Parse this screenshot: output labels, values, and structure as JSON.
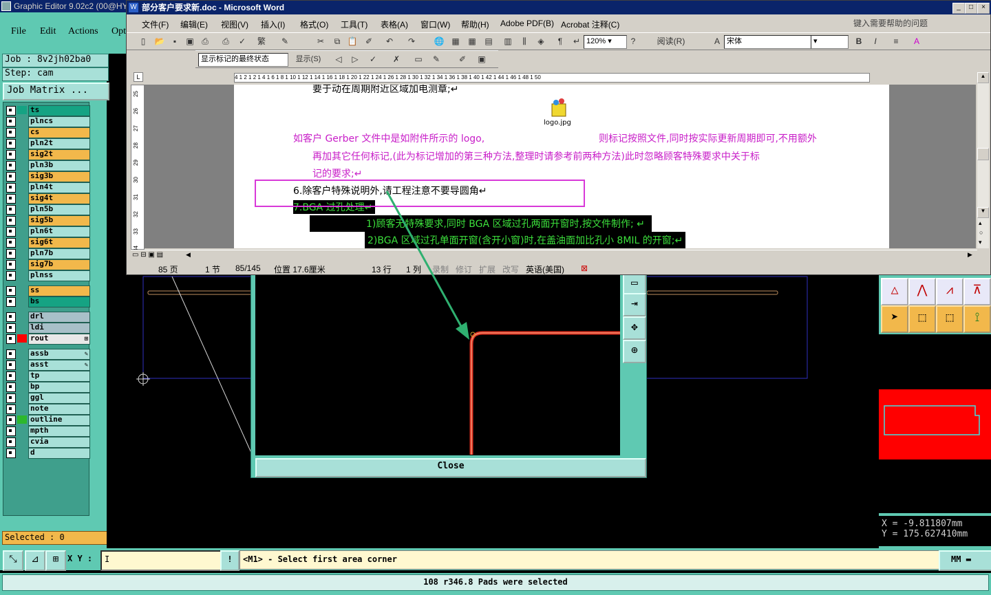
{
  "ge": {
    "title": "Graphic Editor 9.02c2 (00@HY",
    "menu": [
      "File",
      "Edit",
      "Actions",
      "Opt"
    ],
    "job": "Job : 8v2jh02ba0",
    "step": "Step: cam",
    "job_matrix": "Job Matrix ...",
    "layers": [
      {
        "name": "ts",
        "color": "#15a383",
        "swatch": "#15a383"
      },
      {
        "name": "plncs",
        "color": "#a8e0d8",
        "swatch": ""
      },
      {
        "name": "cs",
        "color": "#f2b84b",
        "swatch": ""
      },
      {
        "name": "pln2t",
        "color": "#a8e0d8",
        "swatch": ""
      },
      {
        "name": "sig2t",
        "color": "#f2b84b",
        "swatch": ""
      },
      {
        "name": "pln3b",
        "color": "#a8e0d8",
        "swatch": ""
      },
      {
        "name": "sig3b",
        "color": "#f2b84b",
        "swatch": ""
      },
      {
        "name": "pln4t",
        "color": "#a8e0d8",
        "swatch": ""
      },
      {
        "name": "sig4t",
        "color": "#f2b84b",
        "swatch": ""
      },
      {
        "name": "pln5b",
        "color": "#a8e0d8",
        "swatch": ""
      },
      {
        "name": "sig5b",
        "color": "#f2b84b",
        "swatch": ""
      },
      {
        "name": "pln6t",
        "color": "#a8e0d8",
        "swatch": ""
      },
      {
        "name": "sig6t",
        "color": "#f2b84b",
        "swatch": ""
      },
      {
        "name": "pln7b",
        "color": "#a8e0d8",
        "swatch": ""
      },
      {
        "name": "sig7b",
        "color": "#f2b84b",
        "swatch": ""
      },
      {
        "name": "plnss",
        "color": "#a8e0d8",
        "swatch": ""
      },
      {
        "name": "ss",
        "color": "#f2b84b",
        "swatch": ""
      },
      {
        "name": "bs",
        "color": "#15a383",
        "swatch": ""
      },
      {
        "name": "drl",
        "color": "#a8c0c8",
        "swatch": ""
      },
      {
        "name": "ldi",
        "color": "#a8c0c8",
        "swatch": ""
      },
      {
        "name": "rout",
        "color": "#e8e8e8",
        "swatch": "#ff0000",
        "mark": "⊞"
      },
      {
        "name": "assb",
        "color": "#a8e0d8",
        "swatch": "",
        "mark": "✎"
      },
      {
        "name": "asst",
        "color": "#a8e0d8",
        "swatch": "",
        "mark": "✎"
      },
      {
        "name": "tp",
        "color": "#a8e0d8",
        "swatch": ""
      },
      {
        "name": "bp",
        "color": "#a8e0d8",
        "swatch": ""
      },
      {
        "name": "ggl",
        "color": "#a8e0d8",
        "swatch": ""
      },
      {
        "name": "note",
        "color": "#a8e0d8",
        "swatch": ""
      },
      {
        "name": "outline",
        "color": "#a8e0d8",
        "swatch": "#2db82d"
      },
      {
        "name": "mpth",
        "color": "#a8e0d8",
        "swatch": ""
      },
      {
        "name": "cvia",
        "color": "#a8e0d8",
        "swatch": ""
      },
      {
        "name": "d",
        "color": "#a8e0d8",
        "swatch": ""
      }
    ],
    "selected": "Selected : 0",
    "close_label": "Close",
    "coord_x": "X  =  -9.811807mm",
    "coord_y": "Y  =  175.627410mm",
    "xy_label": "X Y :",
    "xy_value": "I",
    "prompt": "<M1> - Select first area corner",
    "units": "MM",
    "status": "108 r346.8 Pads were selected"
  },
  "word": {
    "title": "部分客户要求新.doc - Microsoft Word",
    "menu": [
      "文件(F)",
      "编辑(E)",
      "视图(V)",
      "插入(I)",
      "格式(O)",
      "工具(T)",
      "表格(A)",
      "窗口(W)",
      "帮助(H)",
      "Adobe PDF(B)",
      "Acrobat 注释(C)"
    ],
    "help_placeholder": "键入需要帮助的问题",
    "zoom": "120%",
    "read_label": "阅读(R)",
    "font": "宋体",
    "markup_state": "显示标记的最终状态",
    "show_label": "显示(S)",
    "ruler_text": "4 1 2 1 2 1 4 1 6 1 8 1 10 1 12 1 14 1 16 1 18 1 20 1 22 1 24 1 26 1 28 1 30 1 32 1 34 1 36 1 38 1 40 1 42 1 44 1 46 1 48 1 50",
    "vruler": [
      "25",
      "26",
      "27",
      "28",
      "29",
      "30",
      "31",
      "32",
      "33",
      "34"
    ],
    "doc_lines": {
      "line0": "要于动在周期附近区域加电测章;↵",
      "image_caption": "logo.jpg",
      "pink1_a": "如客户 Gerber 文件中是如附件所示的 logo,",
      "pink1_b": "则标记按照文件,同时按实际更新周期即可,不用额外",
      "pink2": "再加其它任何标记,(此为标记增加的第三种方法,整理时请参考前两种方法)此时忽略顾客特殊要求中关于标",
      "pink3": "记的要求;↵",
      "item6": "6.除客户特殊说明外,请工程注意不要导圆角↵",
      "item7": "7.BGA 过孔处理↵",
      "sub1": "1)顾客无特殊要求,同时 BGA 区域过孔两面开窗时,按文件制作; ↵",
      "sub2": "2)BGA 区域过孔单面开窗(含开小窗)时,在盖油面加比孔小 8MIL 的开窗;↵"
    },
    "status": {
      "page": "85 页",
      "section": "1 节",
      "pages": "85/145",
      "position": "位置 17.6厘米",
      "line": "13 行",
      "col": "1 列",
      "rec": "录制",
      "trk": "修订",
      "ext": "扩展",
      "ovr": "改写",
      "lang": "英语(美国)"
    }
  },
  "colors": {
    "teal": "#5fc9b2",
    "orange": "#f2b84b",
    "pink": "#d838d8",
    "green_text": "#3ce03c",
    "rout_red": "#ff0000"
  }
}
